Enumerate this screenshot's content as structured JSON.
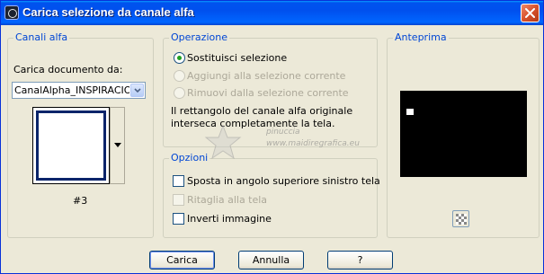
{
  "window": {
    "title": "Carica selezione da canale alfa"
  },
  "canali_alfa": {
    "group_title": "Canali alfa",
    "label": "Carica documento da:",
    "document_value": "CanalAlpha_INSPIRACION",
    "swatch_caption": "#3"
  },
  "operazione": {
    "group_title": "Operazione",
    "options": [
      {
        "label": "Sostituisci selezione",
        "selected": true,
        "enabled": true
      },
      {
        "label": "Aggiungi alla selezione corrente",
        "selected": false,
        "enabled": false
      },
      {
        "label": "Rimuovi dalla selezione corrente",
        "selected": false,
        "enabled": false
      }
    ],
    "description_line1": "Il rettangolo del canale alfa originale",
    "description_line2": "interseca completamente la tela."
  },
  "opzioni": {
    "group_title": "Opzioni",
    "checkboxes": [
      {
        "label": "Sposta in angolo superiore sinistro tela",
        "checked": false,
        "enabled": true
      },
      {
        "label": "Ritaglia alla tela",
        "checked": false,
        "enabled": false
      },
      {
        "label": "Inverti immagine",
        "checked": false,
        "enabled": true
      }
    ]
  },
  "anteprima": {
    "group_title": "Anteprima"
  },
  "buttons": {
    "ok": "Carica",
    "cancel": "Annulla",
    "help": "?"
  },
  "watermark": {
    "line1": "pinuccia",
    "line2": "www.maidiregrafica.eu"
  },
  "colors": {
    "titlebar": "#0054e3",
    "group_title": "#0046d5",
    "dialog_bg": "#ece9d8",
    "disabled_text": "#aca899",
    "radio_selected": "#21a121"
  },
  "icons": {
    "app": "app-icon",
    "close": "close-icon",
    "dropdown": "chevron-down-icon",
    "swatch": "chevron-down-icon",
    "preview_toggle": "checkerboard-icon"
  }
}
